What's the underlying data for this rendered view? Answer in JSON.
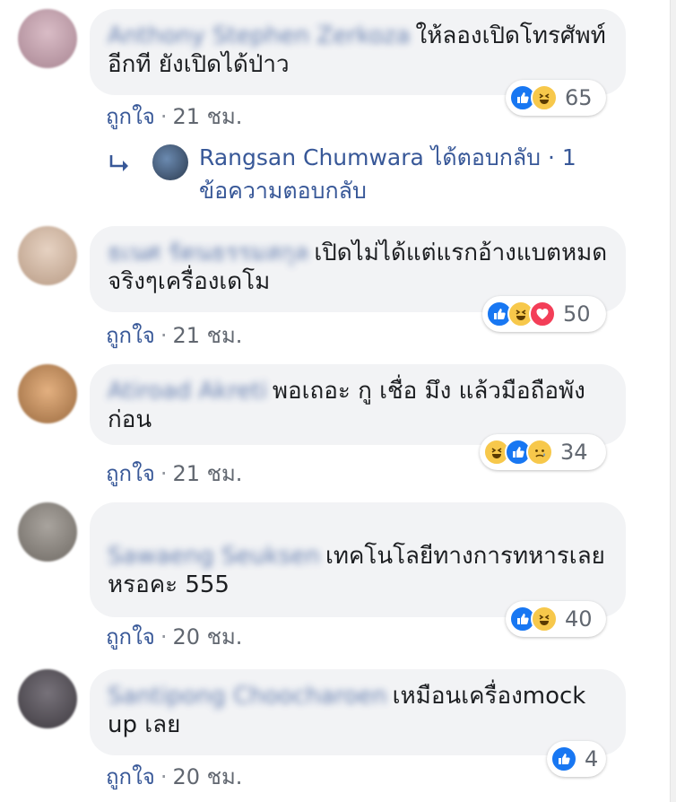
{
  "comments": [
    {
      "author": "Anthony Stephen Zerkoza",
      "text": "ให้ลองเปิดโทรศัพท์อีกที ยังเปิดได้ป่าว",
      "like_label": "ถูกใจ",
      "separator": "·",
      "time": "21 ชม.",
      "reactions": [
        "like-icon",
        "haha-icon"
      ],
      "reaction_count": "65",
      "avatar_color": "#c9a9b4"
    },
    {
      "author": "ธเนศ รัตนธรรมสกุล",
      "text": "เปิดไม่ได้แต่แรกอ้างแบตหมดจริงๆเครื่องเดโม",
      "like_label": "ถูกใจ",
      "separator": "·",
      "time": "21 ชม.",
      "reactions": [
        "like-icon",
        "haha-icon",
        "love-icon"
      ],
      "reaction_count": "50",
      "avatar_color": "#d8c1ae"
    },
    {
      "author": "Atiroad Akreti",
      "text": "พอเถอะ กู เชื่อ มึง แล้วมือถือพังก่อน",
      "like_label": "ถูกใจ",
      "separator": "·",
      "time": "21 ชม.",
      "reactions": [
        "haha-icon",
        "like-icon",
        "sad-icon"
      ],
      "reaction_count": "34",
      "avatar_color": "#c9915e"
    },
    {
      "author": "Sawaeng Seuksen",
      "text": "เทคโนโลยีทางการทหารเลยหรอคะ 555",
      "like_label": "ถูกใจ",
      "separator": "·",
      "time": "20 ชม.",
      "reactions": [
        "like-icon",
        "haha-icon"
      ],
      "reaction_count": "40",
      "avatar_color": "#8f8a84"
    },
    {
      "author": "Santipong Choocharoen",
      "text": "เหมือนเครื่องmock up เลย",
      "like_label": "ถูกใจ",
      "separator": "·",
      "time": "20 ชม.",
      "reactions": [
        "like-icon"
      ],
      "reaction_count": "4",
      "avatar_color": "#5e5a60"
    }
  ],
  "reply": {
    "arrow_icon": "reply-arrow-icon",
    "text": "Rangsan Chumwara ได้ตอบกลับ · 1 ข้อความตอบกลับ"
  },
  "colors": {
    "link": "#385898",
    "bubble": "#f2f3f5",
    "like": "#1877f2",
    "haha": "#f7c84b",
    "love": "#f33e58"
  }
}
